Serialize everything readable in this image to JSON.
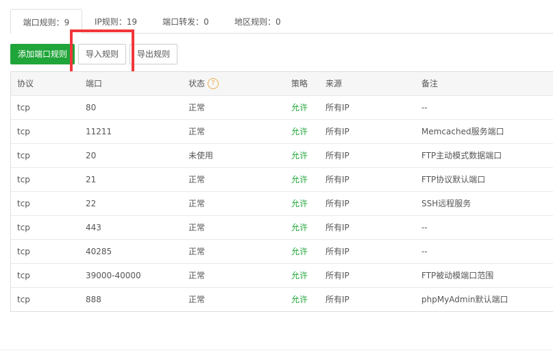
{
  "tabs": [
    {
      "label": "端口规则：9"
    },
    {
      "label": "IP规则：19"
    },
    {
      "label": "端口转发：0"
    },
    {
      "label": "地区规则：0"
    }
  ],
  "toolbar": {
    "add_label": "添加端口规则",
    "import_label": "导入规则",
    "export_label": "导出规则"
  },
  "table": {
    "headers": {
      "protocol": "协议",
      "port": "端口",
      "status": "状态",
      "policy": "策略",
      "source": "来源",
      "remark": "备注"
    },
    "status_help_icon": "?",
    "rows": [
      {
        "protocol": "tcp",
        "port": "80",
        "status": "正常",
        "policy": "允许",
        "source": "所有IP",
        "remark": "--"
      },
      {
        "protocol": "tcp",
        "port": "11211",
        "status": "正常",
        "policy": "允许",
        "source": "所有IP",
        "remark": "Memcached服务端口"
      },
      {
        "protocol": "tcp",
        "port": "20",
        "status": "未使用",
        "policy": "允许",
        "source": "所有IP",
        "remark": "FTP主动模式数据端口"
      },
      {
        "protocol": "tcp",
        "port": "21",
        "status": "正常",
        "policy": "允许",
        "source": "所有IP",
        "remark": "FTP协议默认端口"
      },
      {
        "protocol": "tcp",
        "port": "22",
        "status": "正常",
        "policy": "允许",
        "source": "所有IP",
        "remark": "SSH远程服务"
      },
      {
        "protocol": "tcp",
        "port": "443",
        "status": "正常",
        "policy": "允许",
        "source": "所有IP",
        "remark": "--"
      },
      {
        "protocol": "tcp",
        "port": "40285",
        "status": "正常",
        "policy": "允许",
        "source": "所有IP",
        "remark": "--"
      },
      {
        "protocol": "tcp",
        "port": "39000-40000",
        "status": "正常",
        "policy": "允许",
        "source": "所有IP",
        "remark": "FTP被动模端口范围"
      },
      {
        "protocol": "tcp",
        "port": "888",
        "status": "正常",
        "policy": "允许",
        "source": "所有IP",
        "remark": "phpMyAdmin默认端口"
      }
    ]
  },
  "colors": {
    "primary": "#20a53a",
    "highlight": "#f2363a",
    "help_icon": "#f0ad4e"
  }
}
